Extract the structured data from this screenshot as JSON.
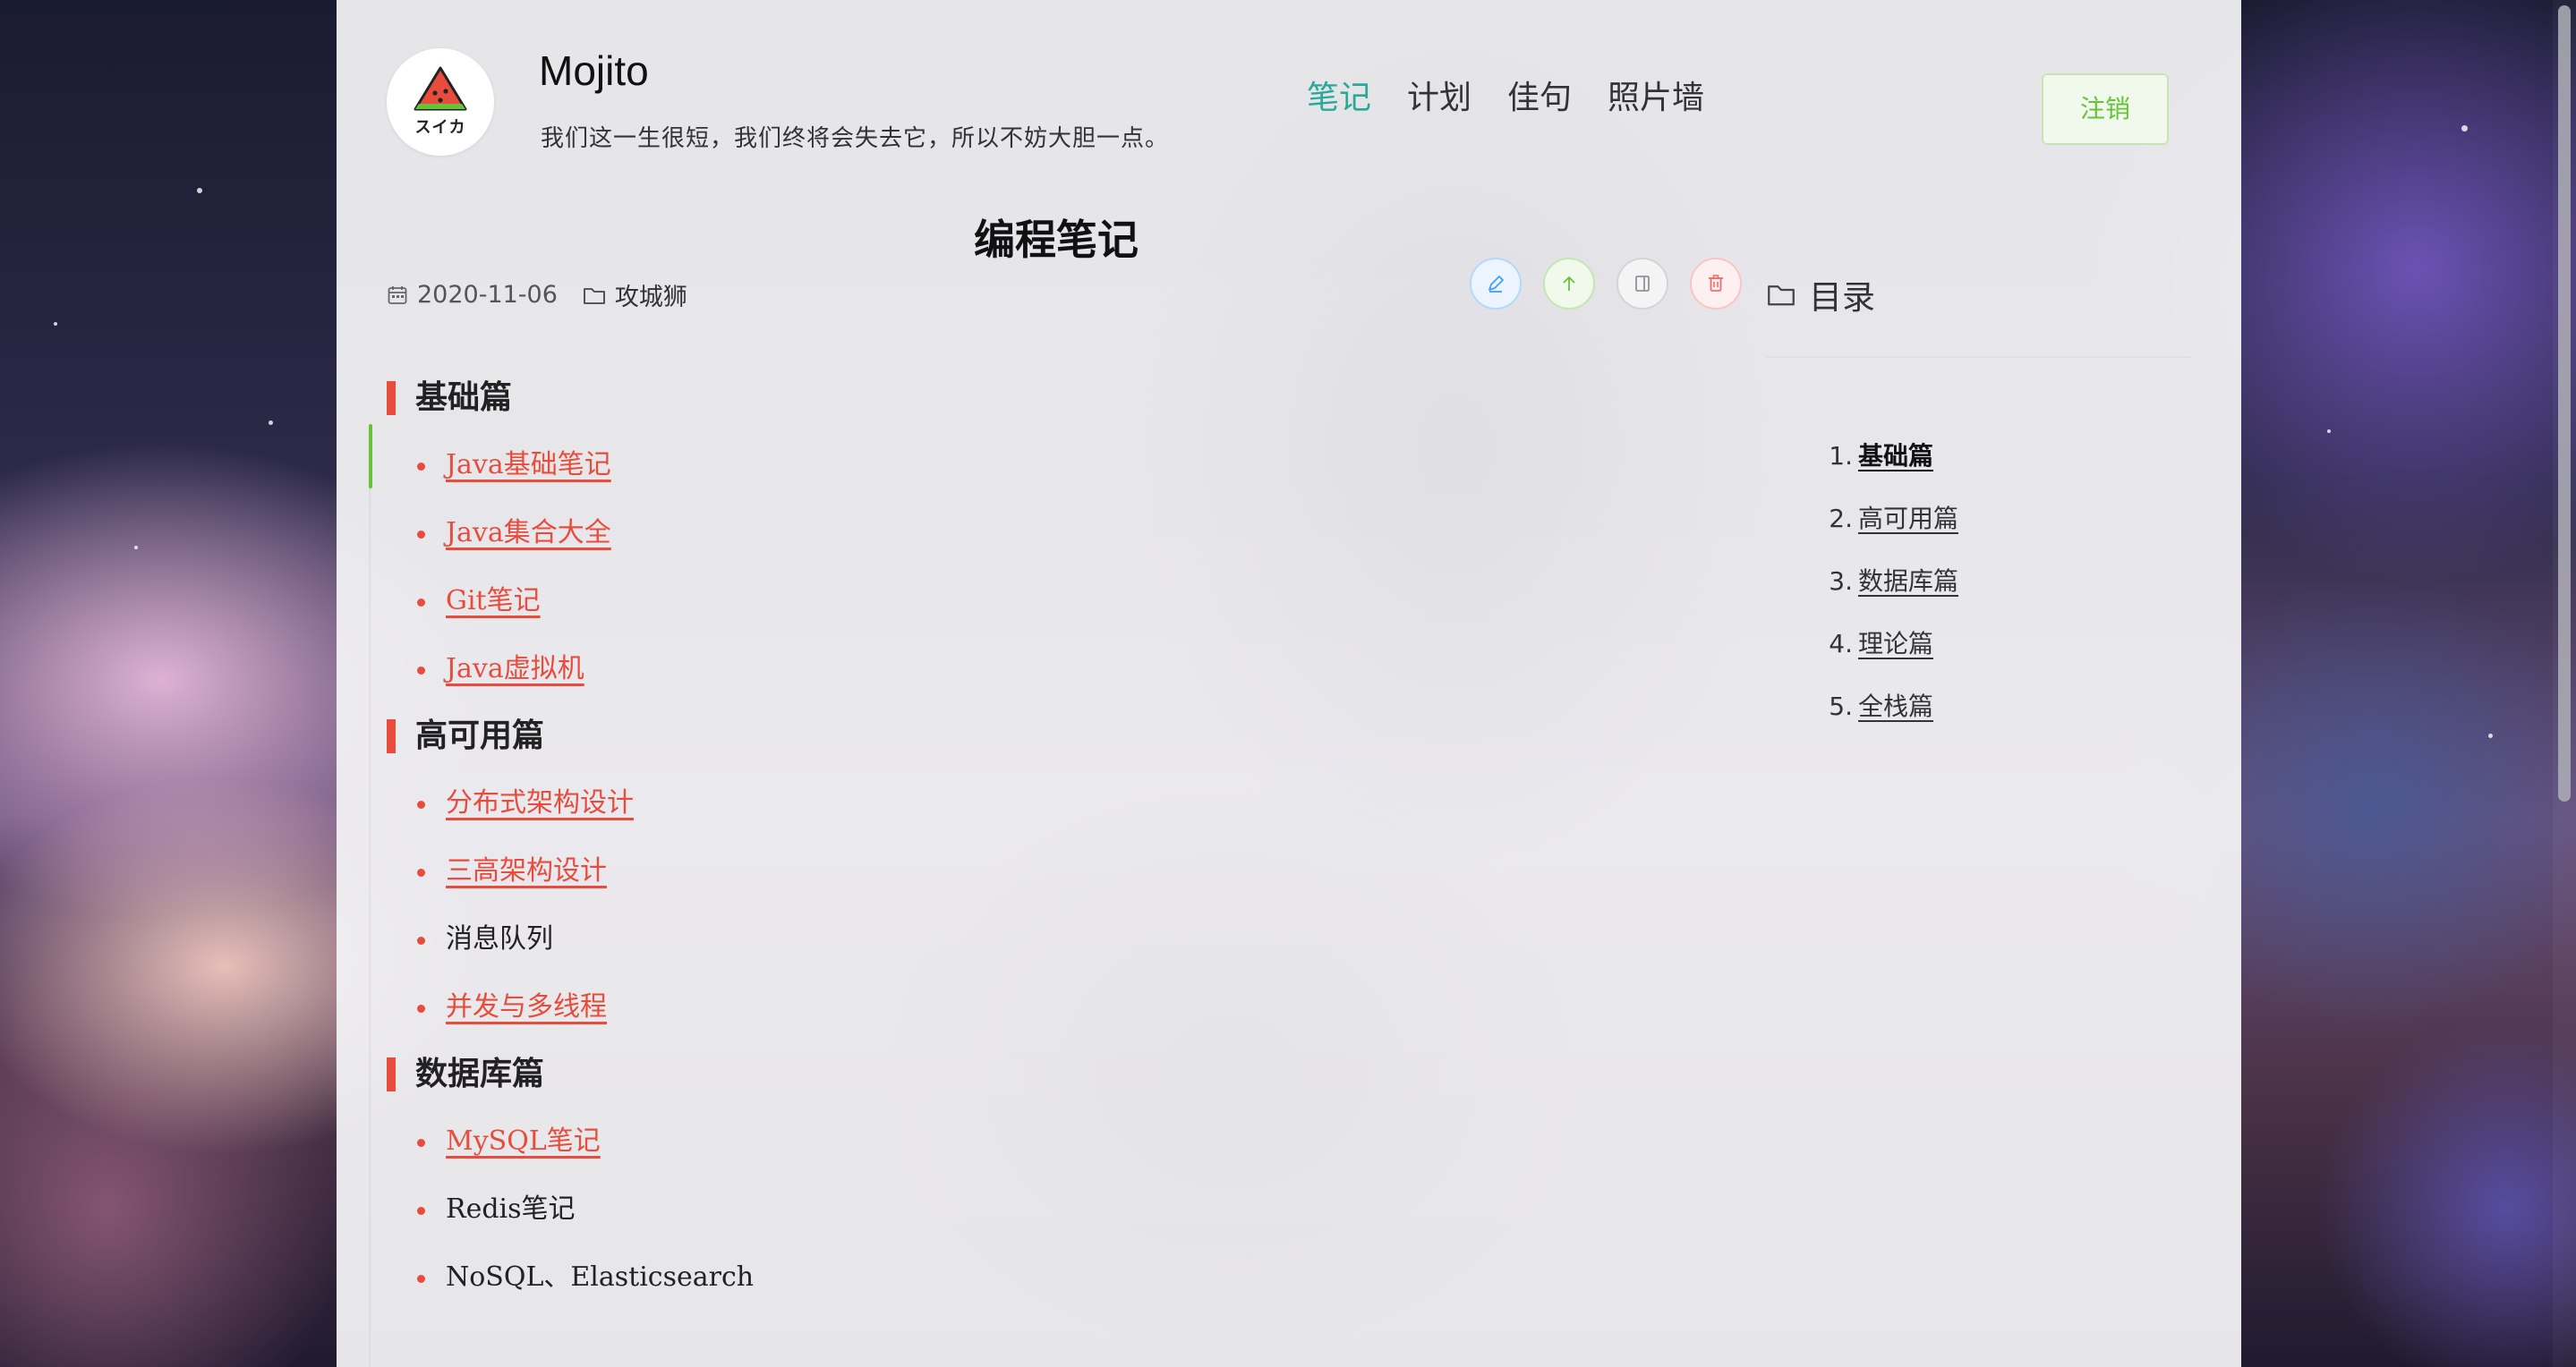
{
  "header": {
    "logo_text": "スイカ",
    "site_name": "Mojito",
    "tagline": "我们这一生很短，我们终将会失去它，所以不妨大胆一点。",
    "nav": [
      {
        "label": "笔记",
        "active": true
      },
      {
        "label": "计划",
        "active": false
      },
      {
        "label": "佳句",
        "active": false
      },
      {
        "label": "照片墙",
        "active": false
      }
    ],
    "logout_label": "注销"
  },
  "article": {
    "title": "编程笔记",
    "date": "2020-11-06",
    "category": "攻城狮",
    "actions": [
      {
        "name": "edit",
        "icon": "pencil-icon",
        "color": "#409eff"
      },
      {
        "name": "up",
        "icon": "arrow-up-icon",
        "color": "#67c23a"
      },
      {
        "name": "book",
        "icon": "book-icon",
        "color": "#909399"
      },
      {
        "name": "delete",
        "icon": "trash-icon",
        "color": "#f56c6c"
      }
    ],
    "sections": [
      {
        "heading": "基础篇",
        "items": [
          {
            "label": "Java基础笔记",
            "link": true
          },
          {
            "label": "Java集合大全",
            "link": true
          },
          {
            "label": "Git笔记",
            "link": true
          },
          {
            "label": "Java虚拟机",
            "link": true
          }
        ]
      },
      {
        "heading": "高可用篇",
        "items": [
          {
            "label": "分布式架构设计",
            "link": true
          },
          {
            "label": "三高架构设计",
            "link": true
          },
          {
            "label": "消息队列",
            "link": false
          },
          {
            "label": "并发与多线程",
            "link": true
          }
        ]
      },
      {
        "heading": "数据库篇",
        "items": [
          {
            "label": "MySQL笔记",
            "link": true
          },
          {
            "label": "Redis笔记",
            "link": false
          },
          {
            "label": "NoSQL、Elasticsearch",
            "link": false
          }
        ]
      }
    ]
  },
  "toc": {
    "title": "目录",
    "items": [
      {
        "num": "1.",
        "label": "基础篇",
        "active": true
      },
      {
        "num": "2.",
        "label": "高可用篇",
        "active": false
      },
      {
        "num": "3.",
        "label": "数据库篇",
        "active": false
      },
      {
        "num": "4.",
        "label": "理论篇",
        "active": false
      },
      {
        "num": "5.",
        "label": "全栈篇",
        "active": false
      }
    ]
  },
  "colors": {
    "accent": "#2aa89a",
    "link": "#e84c3d",
    "success": "#67c23a"
  }
}
